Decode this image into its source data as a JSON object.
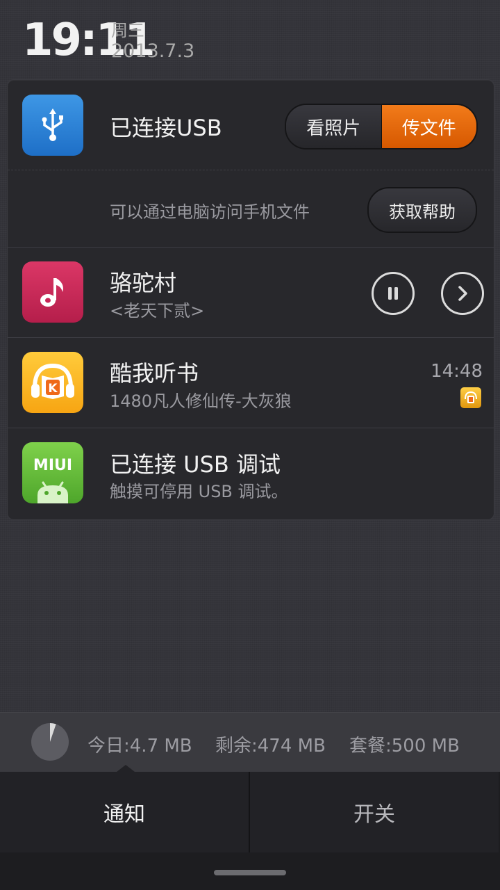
{
  "header": {
    "time": "19:11",
    "weekday": "周三",
    "date": "2013.7.3"
  },
  "notifications": {
    "usb": {
      "title": "已连接USB",
      "photo_label": "看照片",
      "files_label": "传文件",
      "description": "可以通过电脑访问手机文件",
      "help_label": "获取帮助"
    },
    "music": {
      "title": "骆驼村",
      "subtitle": "<老天下贰>"
    },
    "kuwo": {
      "title": "酷我听书",
      "subtitle": "1480凡人修仙传-大灰狼",
      "time": "14:48",
      "icon_letter": "K"
    },
    "usb_debug": {
      "title": "已连接 USB 调试",
      "subtitle": "触摸可停用 USB 调试。",
      "icon_text": "MIUI"
    }
  },
  "data_usage": {
    "today": "今日:4.7 MB",
    "remaining": "剩余:474 MB",
    "plan": "套餐:500 MB",
    "used_fraction": 0.052
  },
  "tabs": {
    "notifications": "通知",
    "toggles": "开关"
  },
  "colors": {
    "accent": "#e0660a",
    "background": "#34343a",
    "panel": "#28282c"
  }
}
